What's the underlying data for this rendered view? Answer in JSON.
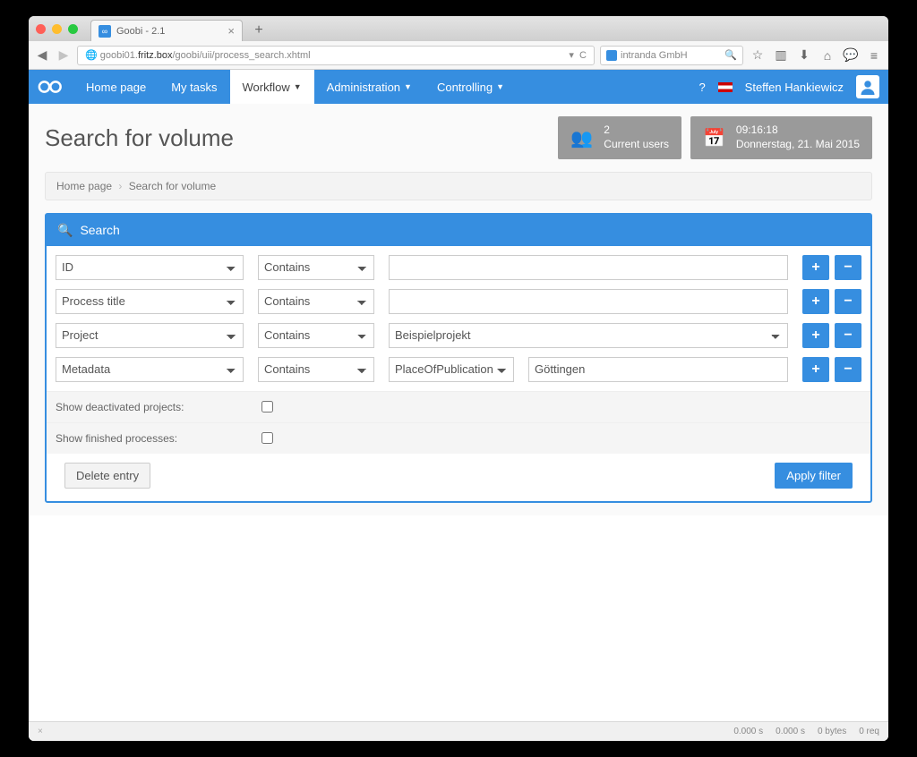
{
  "browser": {
    "tab_title": "Goobi - 2.1",
    "url_prefix": "goobi01.",
    "url_host": "fritz.box",
    "url_path": "/goobi/uii/process_search.xhtml",
    "search_placeholder": "intranda GmbH"
  },
  "topnav": {
    "home": "Home page",
    "tasks": "My tasks",
    "workflow": "Workflow",
    "admin": "Administration",
    "controlling": "Controlling",
    "user": "Steffen Hankiewicz"
  },
  "header": {
    "title": "Search for volume",
    "users_count": "2",
    "users_label": "Current users",
    "time": "09:16:18",
    "date": "Donnerstag, 21. Mai 2015"
  },
  "breadcrumb": {
    "home": "Home page",
    "current": "Search for volume"
  },
  "panel": {
    "title": "Search",
    "rows": [
      {
        "field": "ID",
        "op": "Contains",
        "value": ""
      },
      {
        "field": "Process title",
        "op": "Contains",
        "value": ""
      },
      {
        "field": "Project",
        "op": "Contains",
        "value": "Beispielprojekt"
      },
      {
        "field": "Metadata",
        "op": "Contains",
        "meta": "PlaceOfPublication",
        "value": "Göttingen"
      }
    ],
    "opt_deactivated": "Show deactivated projects:",
    "opt_finished": "Show finished processes:",
    "btn_delete": "Delete entry",
    "btn_apply": "Apply filter"
  },
  "status": {
    "t1": "0.000 s",
    "t2": "0.000 s",
    "bytes": "0 bytes",
    "req": "0 req"
  }
}
